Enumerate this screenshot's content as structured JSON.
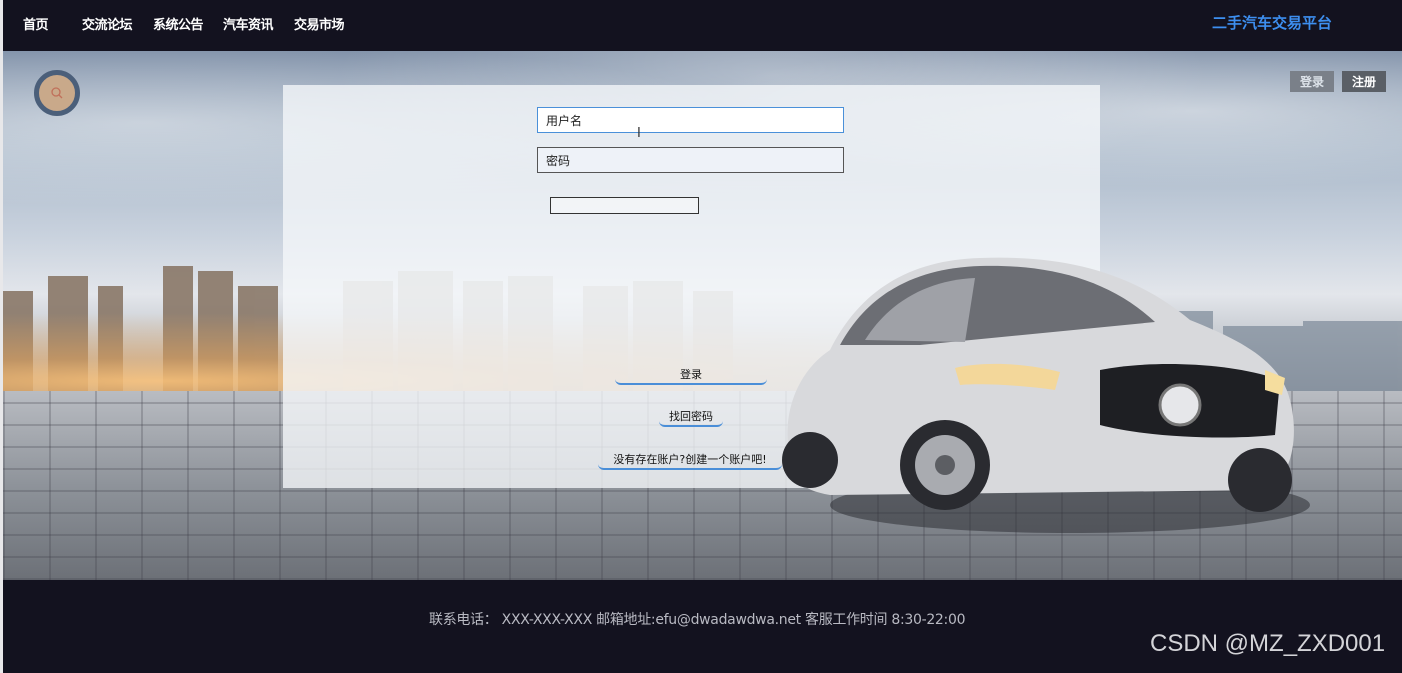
{
  "nav": {
    "items": [
      {
        "label": "首页"
      },
      {
        "label": "交流论坛"
      },
      {
        "label": "系统公告"
      },
      {
        "label": "汽车资讯"
      },
      {
        "label": "交易市场"
      }
    ],
    "brand": "二手汽车交易平台"
  },
  "auth": {
    "login_label": "登录",
    "register_label": "注册"
  },
  "form": {
    "username_value": "用户名",
    "password_value": "密码",
    "login_button": "登录",
    "find_password": "找回密码",
    "create_account": "没有存在账户?创建一个账户吧!"
  },
  "footer": {
    "contact_text": "联系电话： XXX-XXX-XXX 邮箱地址:efu@dwadawdwa.net 客服工作时间 8:30-22:00",
    "watermark": "CSDN @MZ_ZXD001"
  },
  "colors": {
    "brand": "#3d8ff0",
    "nav_bg": "#13121f",
    "accent_underline": "#4a8ed8"
  },
  "icons": {
    "search": "search-icon",
    "cursor": "text-cursor-icon"
  }
}
